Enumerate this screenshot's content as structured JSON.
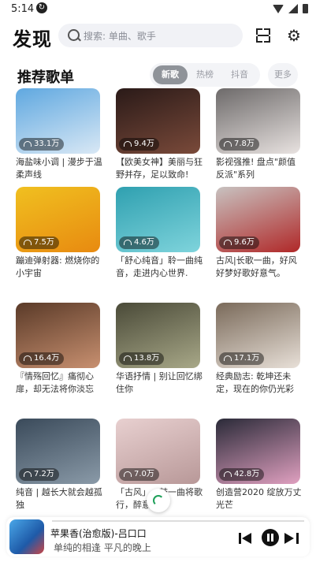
{
  "status": {
    "time": "5:14",
    "sync_icon": "sync-icon"
  },
  "header": {
    "logo": "发现",
    "search_placeholder": "搜索: 单曲、歌手"
  },
  "section": {
    "title": "推荐歌单",
    "tabs": [
      {
        "label": "新歌",
        "active": true
      },
      {
        "label": "热榜",
        "active": false
      },
      {
        "label": "抖音",
        "active": false
      }
    ],
    "more_label": "更多"
  },
  "playlists": [
    {
      "plays": "33.1万",
      "title": "海盐味小调 | 漫步于温柔声线",
      "colors": [
        "#5fa8e0",
        "#d9e8f5"
      ]
    },
    {
      "plays": "9.4万",
      "title": "【欧美女神】美丽与狂野并存，足以致命!",
      "colors": [
        "#2a1a18",
        "#7a4a3a"
      ]
    },
    {
      "plays": "7.8万",
      "title": "影视强推! 盘点\"颜值反派\"系列",
      "colors": [
        "#6d6a6a",
        "#e8e2e0"
      ]
    },
    {
      "plays": "7.5万",
      "title": "蹦迪弹射器: 燃烧你的小宇宙",
      "colors": [
        "#f0c020",
        "#e88a10"
      ]
    },
    {
      "plays": "4.6万",
      "title": "「舒心纯音」聆一曲纯音，走进内心世界.",
      "colors": [
        "#2fa0b0",
        "#7fd4dc"
      ]
    },
    {
      "plays": "9.6万",
      "title": "古风|长歌一曲，好风好梦好歌好意气。",
      "colors": [
        "#c8c2c0",
        "#b02828"
      ]
    },
    {
      "plays": "16.4万",
      "title": "『情殇回忆』痛彻心扉，却无法将你淡忘",
      "colors": [
        "#5a3a28",
        "#c89070"
      ]
    },
    {
      "plays": "13.8万",
      "title": "华语抒情 | 别让回忆绑住你",
      "colors": [
        "#4a4a38",
        "#a8a888"
      ]
    },
    {
      "plays": "17.1万",
      "title": "经典励志: 乾坤还未定，现在的你仍光彩",
      "colors": [
        "#7a6a5a",
        "#e8e0d8"
      ]
    },
    {
      "plays": "7.2万",
      "title": "纯音 | 越长大就会越孤独",
      "colors": [
        "#3a4a5a",
        "#8a9aa8"
      ]
    },
    {
      "plays": "7.0万",
      "title": "「古风」一鼓一曲将歌行，醉意且来",
      "colors": [
        "#e8d0d0",
        "#b89898"
      ]
    },
    {
      "plays": "42.8万",
      "title": "创造营2020 绽放万丈光芒",
      "colors": [
        "#2a2a38",
        "#e0a0c0"
      ]
    }
  ],
  "player": {
    "title": "苹果香(治愈版)-吕口口",
    "subtitle": "单纯的相逢 平凡的晚上"
  }
}
